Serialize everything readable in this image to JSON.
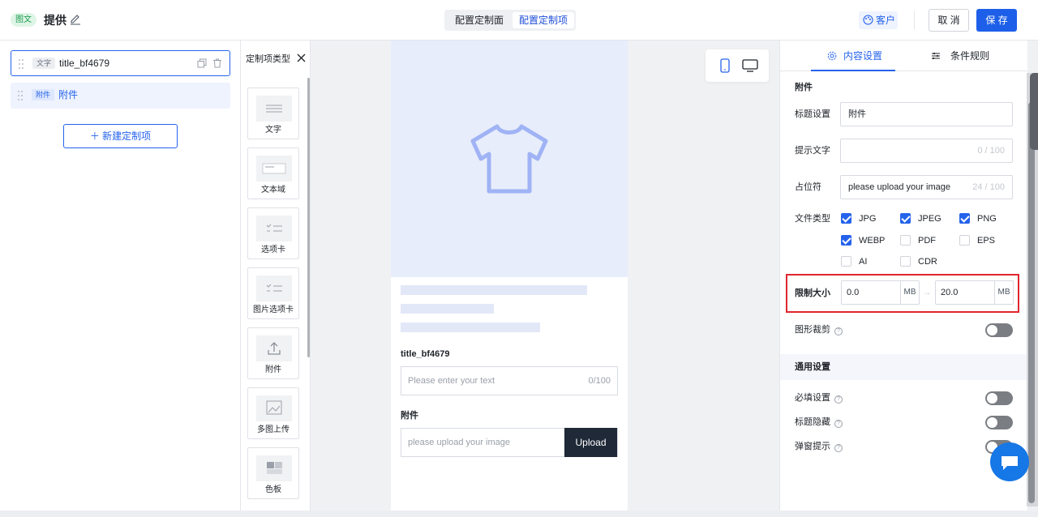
{
  "header": {
    "tag": "图文",
    "title": "提供",
    "tabs": [
      {
        "label": "配置定制面",
        "active": false
      },
      {
        "label": "配置定制项",
        "active": true
      }
    ],
    "customer_label": "客户",
    "cancel_label": "取 消",
    "save_label": "保 存"
  },
  "left_panel": {
    "items": [
      {
        "tag": "文字",
        "label": "title_bf4679",
        "selected": true
      },
      {
        "tag": "附件",
        "label": "附件",
        "selected": false
      }
    ],
    "new_button": "新建定制项"
  },
  "types_panel": {
    "title": "定制项类型",
    "cards": [
      {
        "label": "文字",
        "icon": "text-lines-icon"
      },
      {
        "label": "文本域",
        "icon": "textarea-icon"
      },
      {
        "label": "选项卡",
        "icon": "checklist-icon"
      },
      {
        "label": "图片选项卡",
        "icon": "image-checklist-icon"
      },
      {
        "label": "附件",
        "icon": "upload-icon"
      },
      {
        "label": "多图上传",
        "icon": "image-icon"
      },
      {
        "label": "色板",
        "icon": "palette-icon"
      }
    ]
  },
  "preview": {
    "field1": {
      "title": "title_bf4679",
      "placeholder": "Please enter your text",
      "count": "0/100"
    },
    "field2": {
      "title": "附件",
      "placeholder": "please upload your image",
      "button": "Upload"
    }
  },
  "right_panel": {
    "tabs": [
      "内容设置",
      "条件规则"
    ],
    "section_title": "附件",
    "rows": {
      "title_label": "标题设置",
      "title_value": "附件",
      "hint_label": "提示文字",
      "hint_value": "",
      "hint_count": "0 / 100",
      "placeholder_label": "占位符",
      "placeholder_value": "please upload your image",
      "placeholder_count": "24 / 100",
      "filetype_label": "文件类型",
      "size_label": "限制大小",
      "size_min": "0.0",
      "size_max": "20.0",
      "size_unit": "MB",
      "crop_label": "图形裁剪"
    },
    "file_types": [
      {
        "label": "JPG",
        "checked": true
      },
      {
        "label": "JPEG",
        "checked": true
      },
      {
        "label": "PNG",
        "checked": true
      },
      {
        "label": "WEBP",
        "checked": true
      },
      {
        "label": "PDF",
        "checked": false
      },
      {
        "label": "EPS",
        "checked": false
      },
      {
        "label": "AI",
        "checked": false
      },
      {
        "label": "CDR",
        "checked": false
      }
    ],
    "general": {
      "title": "通用设置",
      "required_label": "必填设置",
      "hide_title_label": "标题隐藏",
      "popup_label": "弹窗提示"
    }
  },
  "colors": {
    "accent": "#1d5fe8",
    "highlight_box": "#e0262f",
    "hero_bg": "#e8edfb"
  }
}
